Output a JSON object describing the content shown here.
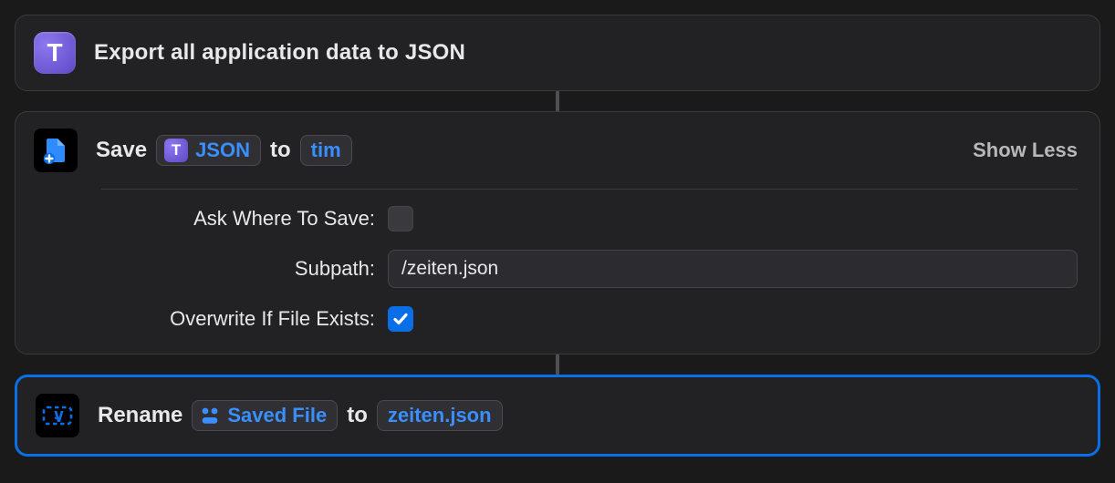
{
  "action1": {
    "icon_letter": "T",
    "title": "Export all application data to JSON"
  },
  "action2": {
    "title_prefix": "Save",
    "var_token": {
      "icon_letter": "T",
      "label": "JSON"
    },
    "joiner": "to",
    "dest_token": "tim",
    "show_less": "Show Less",
    "options": {
      "ask_where_label": "Ask Where To Save:",
      "ask_where_checked": false,
      "subpath_label": "Subpath:",
      "subpath_value": "/zeiten.json",
      "overwrite_label": "Overwrite If File Exists:",
      "overwrite_checked": true
    }
  },
  "action3": {
    "title_prefix": "Rename",
    "file_token": "Saved File",
    "joiner": "to",
    "name_token": "zeiten.json"
  }
}
